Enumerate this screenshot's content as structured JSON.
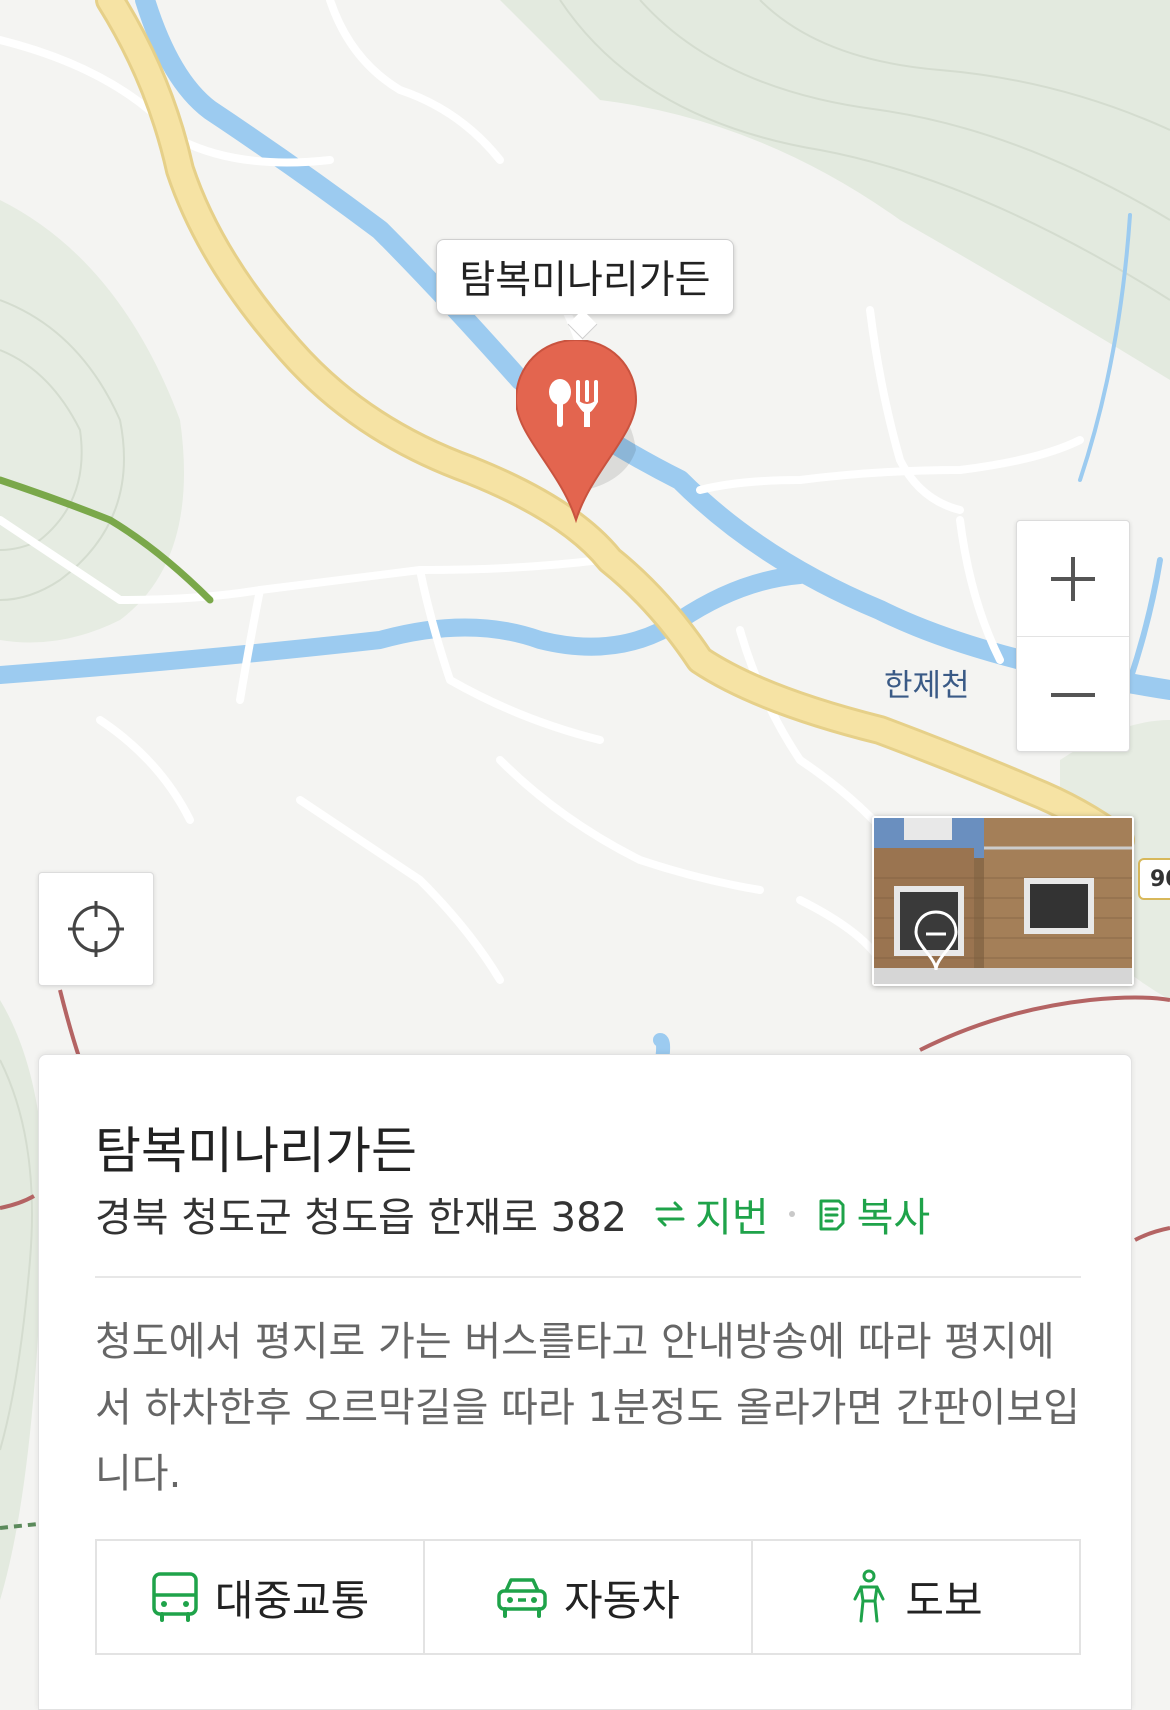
{
  "marker": {
    "label": "탐복미나리가든",
    "category_icon": "restaurant-icon",
    "color": "#e3654f"
  },
  "map": {
    "river_label": "한제천",
    "road_badge": "90",
    "colors": {
      "land": "#f4f4f2",
      "water": "#9ccbf0",
      "main_road": "#f6e3a4",
      "forest": "#dfe7da",
      "trail": "#7aa84a"
    }
  },
  "controls": {
    "zoom_in_icon": "plus-icon",
    "zoom_out_icon": "minus-icon",
    "locate_icon": "crosshair-icon",
    "street_view_icon": "street-view-pin-icon"
  },
  "place": {
    "name": "탐복미나리가든",
    "address": "경북 청도군 청도읍 한재로 382",
    "jibun_label": "지번",
    "copy_label": "복사",
    "description": "청도에서 평지로 가는 버스를타고 안내방송에 따라 평지에서 하차한후 오르막길을 따라 1분정도 올라가면 간판이보입니다.",
    "accent_color": "#1fa34a"
  },
  "directions": [
    {
      "label": "대중교통",
      "icon": "bus-icon"
    },
    {
      "label": "자동차",
      "icon": "car-icon"
    },
    {
      "label": "도보",
      "icon": "walk-icon"
    }
  ]
}
